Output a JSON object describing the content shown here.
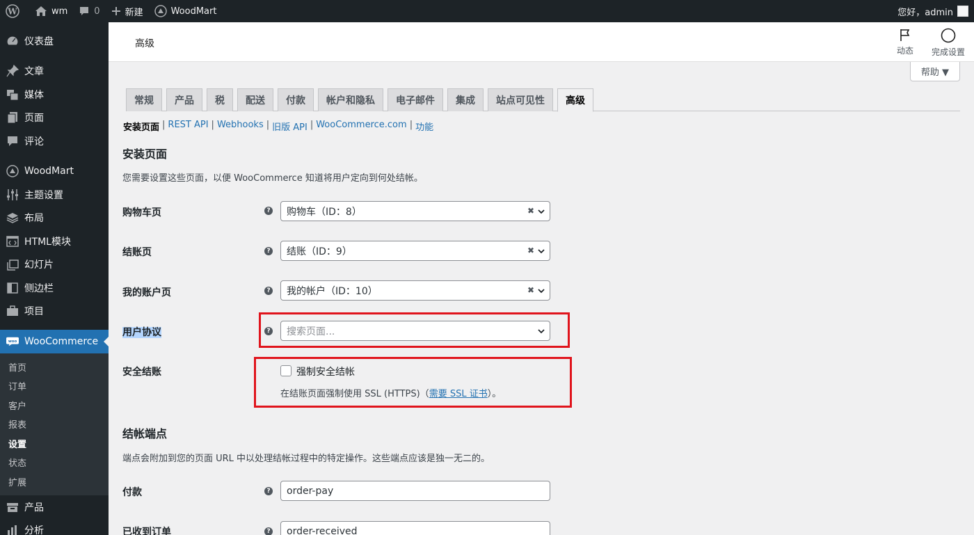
{
  "adminbar": {
    "site_name": "wm",
    "comments_count": "0",
    "new_label": "新建",
    "woodmart_label": "WoodMart",
    "greeting": "您好，admin"
  },
  "sidebar": {
    "items": [
      {
        "label": "仪表盘",
        "icon": "dashboard-icon"
      },
      {
        "label": "文章",
        "icon": "pin-icon"
      },
      {
        "label": "媒体",
        "icon": "media-icon"
      },
      {
        "label": "页面",
        "icon": "page-icon"
      },
      {
        "label": "评论",
        "icon": "comment-icon"
      },
      {
        "label": "WoodMart",
        "icon": "woodmart-icon"
      },
      {
        "label": "主题设置",
        "icon": "sliders-icon"
      },
      {
        "label": "布局",
        "icon": "layers-icon"
      },
      {
        "label": "HTML模块",
        "icon": "html-icon"
      },
      {
        "label": "幻灯片",
        "icon": "slides-icon"
      },
      {
        "label": "侧边栏",
        "icon": "sidebar-icon"
      },
      {
        "label": "项目",
        "icon": "portfolio-icon"
      },
      {
        "label": "WooCommerce",
        "icon": "woo-icon"
      }
    ],
    "submenu": [
      "首页",
      "订单",
      "客户",
      "报表",
      "设置",
      "状态",
      "扩展"
    ],
    "after": [
      {
        "label": "产品",
        "icon": "products-icon"
      },
      {
        "label": "分析",
        "icon": "analytics-icon"
      }
    ]
  },
  "header": {
    "title": "高级",
    "activity_label": "动态",
    "setup_label": "完成设置",
    "help_label": "帮助 ▼"
  },
  "tabs": [
    "常规",
    "产品",
    "税",
    "配送",
    "付款",
    "帐户和隐私",
    "电子邮件",
    "集成",
    "站点可见性",
    "高级"
  ],
  "subnav": {
    "current": "安装页面",
    "links": [
      "REST API",
      "Webhooks",
      "旧版 API",
      "WooCommerce.com",
      "功能"
    ]
  },
  "setup_pages": {
    "title": "安装页面",
    "description": "您需要设置这些页面，以便 WooCommerce 知道将用户定向到何处结帐。",
    "cart_label": "购物车页",
    "cart_value": "购物车（ID：8）",
    "checkout_label": "结账页",
    "checkout_value": "结账（ID：9）",
    "account_label": "我的账户页",
    "account_value": "我的帐户（ID：10）",
    "terms_label": "用户协议",
    "terms_placeholder": "搜索页面...",
    "secure_label": "安全结账",
    "secure_checkbox_label": "强制安全结帐",
    "secure_desc_pre": "在结账页面强制使用 SSL (HTTPS)（",
    "secure_desc_link": "需要 SSL 证书",
    "secure_desc_post": "）。"
  },
  "endpoints": {
    "title": "结帐端点",
    "description": "端点会附加到您的页面 URL 中以处理结帐过程中的特定操作。这些端点应该是独一无二的。",
    "pay_label": "付款",
    "pay_value": "order-pay",
    "received_label": "已收到订单",
    "received_value": "order-received"
  },
  "colors": {
    "accent": "#2271b1",
    "sidebar_bg": "#1d2327",
    "highlight_box": "#e0141c"
  }
}
